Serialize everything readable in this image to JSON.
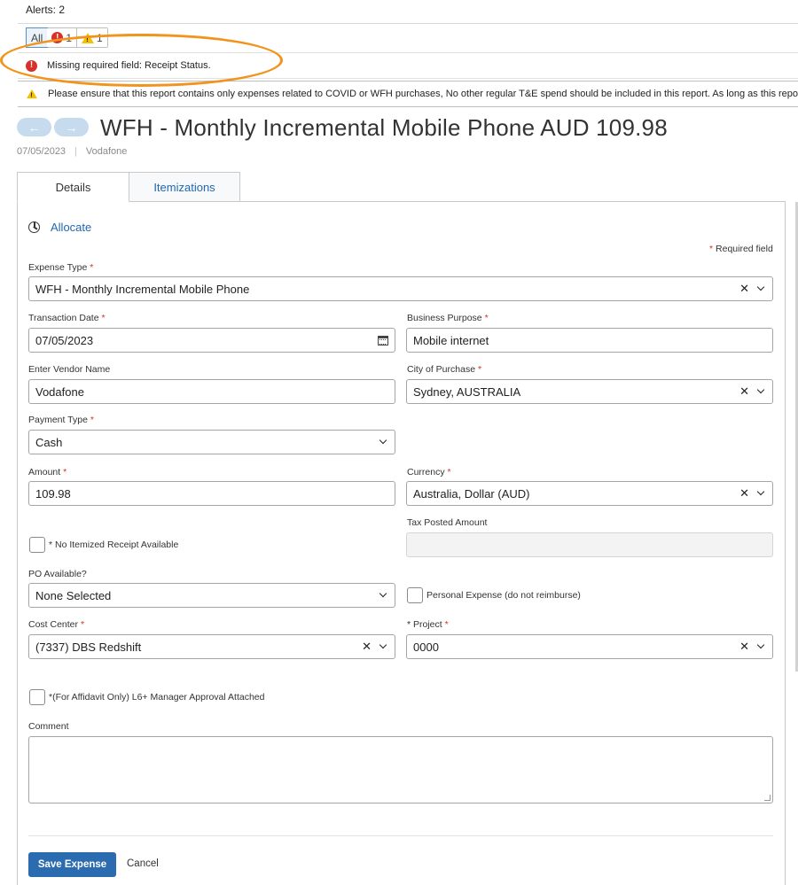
{
  "alerts": {
    "count_label": "Alerts: 2",
    "filters": [
      {
        "label": "All"
      },
      {
        "label": "1",
        "icon": "error-icon"
      },
      {
        "label": "1",
        "icon": "warning-icon"
      }
    ],
    "error_message": "Missing required field: Receipt Status.",
    "warning_message": "Please ensure that this report contains only expenses related to COVID or WFH purchases, No other regular T&E spend should be included in this report. As long as this report contains o"
  },
  "header": {
    "prev_arrow": "←",
    "next_arrow": "→",
    "title": "WFH - Monthly Incremental Mobile Phone AUD 109.98",
    "date": "07/05/2023",
    "vendor": "Vodafone"
  },
  "tabs": [
    {
      "label": "Details"
    },
    {
      "label": "Itemizations"
    }
  ],
  "form": {
    "allocate_label": "Allocate",
    "required_note": "Required field",
    "required_star": "*",
    "expense_type": {
      "label": "Expense Type",
      "value": "WFH - Monthly Incremental Mobile Phone"
    },
    "transaction_date": {
      "label": "Transaction Date",
      "value": "07/05/2023"
    },
    "business_purpose": {
      "label": "Business Purpose",
      "value": "Mobile internet"
    },
    "vendor_name": {
      "label": "Enter Vendor Name",
      "value": "Vodafone"
    },
    "city_of_purchase": {
      "label": "City of Purchase",
      "value": "Sydney, AUSTRALIA"
    },
    "payment_type": {
      "label": "Payment Type",
      "value": "Cash"
    },
    "amount": {
      "label": "Amount",
      "value": "109.98"
    },
    "currency": {
      "label": "Currency",
      "value": "Australia, Dollar (AUD)"
    },
    "no_itemized_receipt": {
      "label": "* No Itemized Receipt Available"
    },
    "tax_posted_amount": {
      "label": "Tax Posted Amount",
      "value": ""
    },
    "po_available": {
      "label": "PO Available?",
      "value": "None Selected"
    },
    "personal_expense": {
      "label": "Personal Expense (do not reimburse)"
    },
    "cost_center": {
      "label": "Cost Center",
      "value": "(7337) DBS Redshift"
    },
    "project": {
      "label": "* Project",
      "value": "0000"
    },
    "affidavit": {
      "label": "*(For Affidavit Only) L6+ Manager Approval Attached"
    },
    "comment": {
      "label": "Comment",
      "value": ""
    }
  },
  "actions": {
    "save_label": "Save Expense",
    "cancel_label": "Cancel"
  },
  "colors": {
    "accent": "#2b6cb0",
    "link": "#2068b0",
    "error": "#d6312b",
    "warning": "#f2c200",
    "annotation": "#f2931c"
  }
}
